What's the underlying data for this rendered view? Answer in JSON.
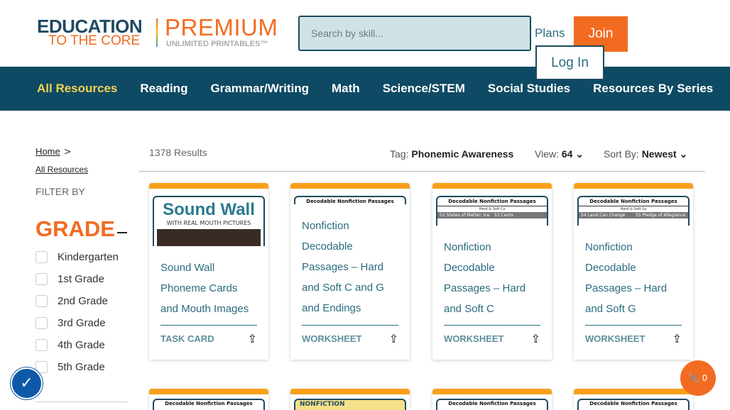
{
  "header": {
    "logo": {
      "line1": "EDUCATION",
      "line2": "TO THE CORE",
      "premium": "PREMIUM",
      "tagline": "UNLIMITED PRINTABLES™"
    },
    "search_placeholder": "Search by skill...",
    "plans": "Plans",
    "join": "Join",
    "login": "Log In"
  },
  "nav": [
    "All Resources",
    "Reading",
    "Grammar/Writing",
    "Math",
    "Science/STEM",
    "Social Studies",
    "Resources By Series"
  ],
  "breadcrumb": {
    "home": "Home",
    "sep": ">",
    "all": "All Resources"
  },
  "sidebar": {
    "filter_by": "FILTER BY",
    "grade_heading": "GRADE",
    "grades": [
      "Kindergarten",
      "1st Grade",
      "2nd Grade",
      "3rd Grade",
      "4th Grade",
      "5th Grade"
    ]
  },
  "results": {
    "count": "1378 Results",
    "tag_label": "Tag:",
    "tag_value": "Phonemic Awareness",
    "view_label": "View:",
    "view_value": "64",
    "sort_label": "Sort By:",
    "sort_value": "Newest"
  },
  "cards": [
    {
      "title_lines": [
        "Sound Wall",
        "Phoneme Cards",
        "and Mouth Images"
      ],
      "type": "TASK CARD",
      "thumb": {
        "big": "Sound Wall",
        "sub": "WITH REAL MOUTH PICTURES"
      }
    },
    {
      "title_lines": [
        "Nonfiction",
        "Decodable",
        "Passages – Hard",
        "and Soft C and G",
        "and Endings"
      ],
      "type": "WORKSHEET",
      "thumb": {
        "title": "Decodable Nonfiction Passages"
      }
    },
    {
      "title_lines": [
        "Nonfiction",
        "Decodable",
        "Passages – Hard",
        "and Soft C"
      ],
      "type": "WORKSHEET",
      "thumb": {
        "title": "Decodable Nonfiction Passages",
        "sub": "Hard & Soft Cs",
        "cols": [
          "52 States of Matter: Ice",
          "53 Cents"
        ]
      }
    },
    {
      "title_lines": [
        "Nonfiction",
        "Decodable",
        "Passages – Hard",
        "and Soft G"
      ],
      "type": "WORKSHEET",
      "thumb": {
        "title": "Decodable Nonfiction Passages",
        "sub": "Hard & Soft Gs",
        "cols": [
          "54 Land Can Change",
          "55 Pledge of Allegiance"
        ]
      }
    }
  ],
  "row2_thumbs": [
    "Decodable Nonfiction Passages",
    "NONFICTION",
    "Decodable Nonfiction Passages",
    "Decodable Nonfiction Passages"
  ],
  "widgets": {
    "attachments_count": "0"
  },
  "colors": {
    "brand_navy": "#0e4a63",
    "accent_orange": "#f26b21",
    "card_top": "#f9a01b",
    "nav_active": "#f7d154"
  }
}
